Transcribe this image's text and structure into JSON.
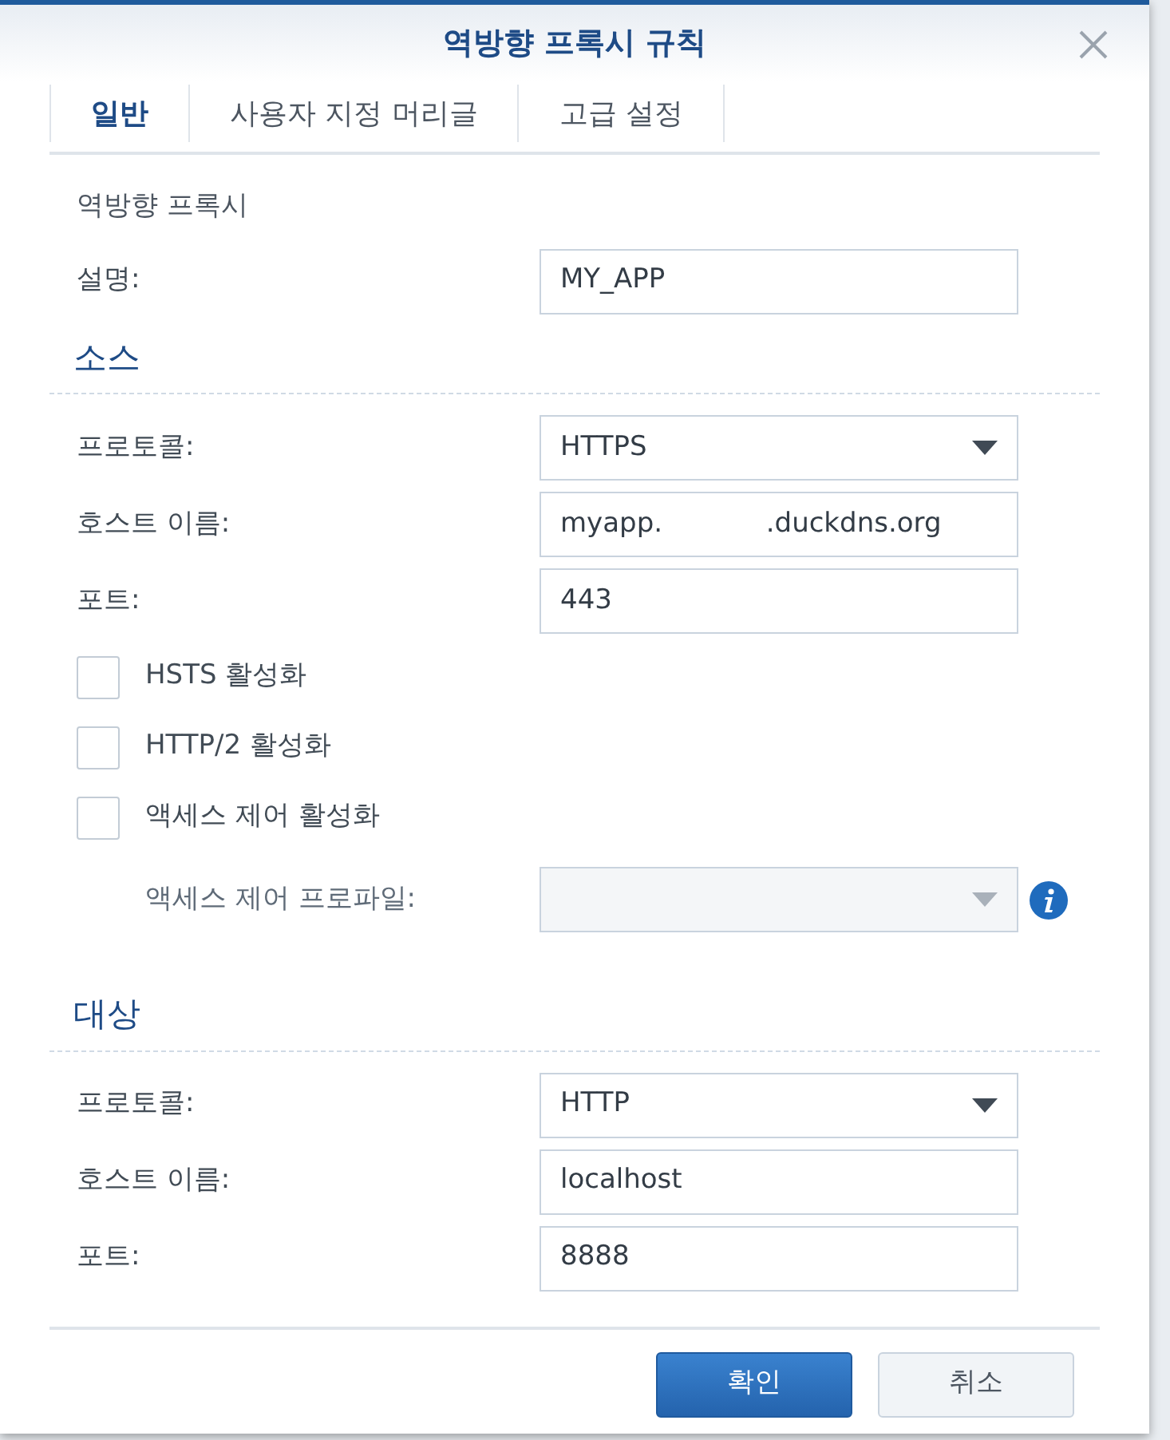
{
  "window": {
    "title": "역방향 프록시 규칙"
  },
  "tabs": [
    {
      "label": "일반",
      "selected": true
    },
    {
      "label": "사용자 지정 머리글",
      "selected": false
    },
    {
      "label": "고급 설정",
      "selected": false
    }
  ],
  "intro": "역방향 프록시",
  "description": {
    "label": "설명:",
    "value": "MY_APP"
  },
  "source": {
    "heading": "소스",
    "fields": [
      {
        "kind": "select",
        "label": "프로토콜:",
        "value": "HTTPS"
      },
      {
        "kind": "text",
        "label": "호스트 이름:",
        "value": "myapp.            .duckdns.org"
      },
      {
        "kind": "text",
        "label": "포트:",
        "value": "443"
      }
    ],
    "options": [
      {
        "kind": "checkbox",
        "label": "HSTS 활성화",
        "checked": false,
        "disabled": false
      },
      {
        "kind": "checkbox",
        "label": "HTTP/2 활성화",
        "checked": false,
        "disabled": false
      },
      {
        "kind": "checkbox",
        "label": "액세스 제어 활성화",
        "checked": false,
        "disabled": false
      },
      {
        "kind": "select",
        "label": "액세스 제어 프로파일:",
        "disabled": true
      }
    ]
  },
  "destination": {
    "heading": "대상",
    "fields": [
      {
        "kind": "select",
        "label": "프로토콜:",
        "value": "HTTP"
      },
      {
        "kind": "text",
        "label": "호스트 이름:",
        "value": "localhost"
      },
      {
        "kind": "text",
        "label": "포트:",
        "value": "8888"
      }
    ]
  },
  "buttons": [
    {
      "label": "확인",
      "kind": "primary"
    },
    {
      "label": "취소",
      "kind": "secondary"
    }
  ]
}
